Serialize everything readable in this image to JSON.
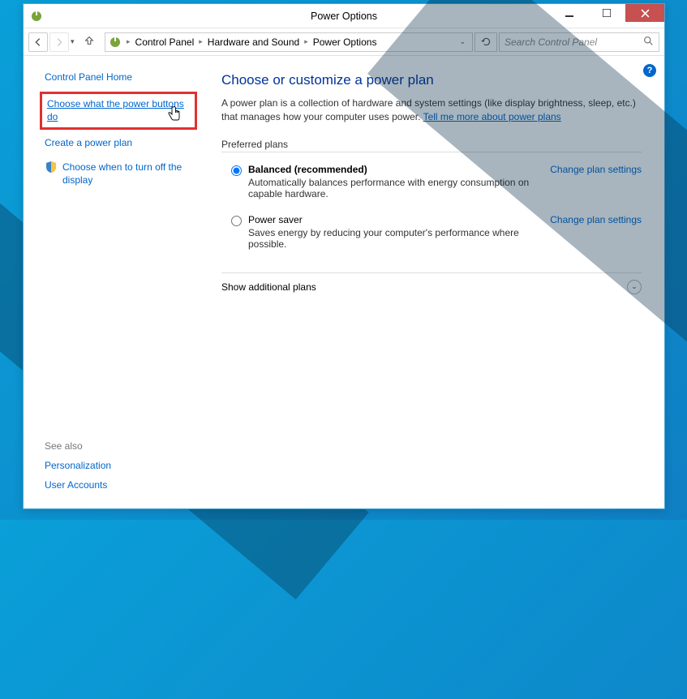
{
  "window": {
    "title": "Power Options"
  },
  "breadcrumbs": [
    "Control Panel",
    "Hardware and Sound",
    "Power Options"
  ],
  "search": {
    "placeholder": "Search Control Panel"
  },
  "sidebar": {
    "home": "Control Panel Home",
    "choose_buttons": "Choose what the power buttons do",
    "create_plan": "Create a power plan",
    "turn_off_display": "Choose when to turn off the display",
    "see_also_hdr": "See also",
    "personalization": "Personalization",
    "user_accounts": "User Accounts"
  },
  "main": {
    "heading": "Choose or customize a power plan",
    "lead_pre": "A power plan is a collection of hardware and system settings (like display brightness, sleep, etc.) that manages how your computer uses power. ",
    "lead_link": "Tell me more about power plans",
    "preferred_hdr": "Preferred plans",
    "plans": [
      {
        "name": "Balanced (recommended)",
        "desc": "Automatically balances performance with energy consumption on capable hardware.",
        "link": "Change plan settings",
        "selected": true
      },
      {
        "name": "Power saver",
        "desc": "Saves energy by reducing your computer's performance where possible.",
        "link": "Change plan settings",
        "selected": false
      }
    ],
    "show_additional": "Show additional plans"
  },
  "help_tooltip": "?"
}
